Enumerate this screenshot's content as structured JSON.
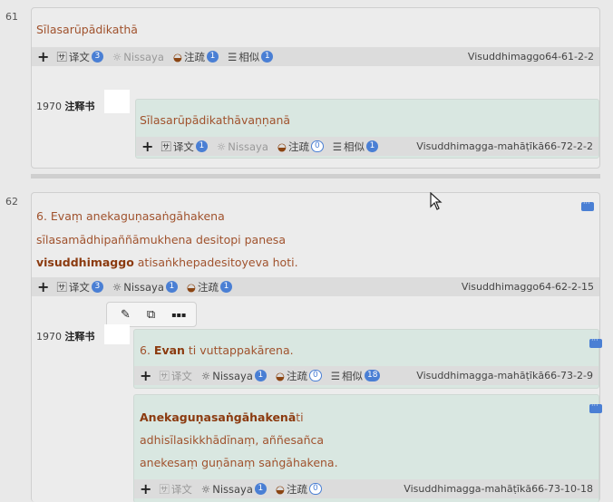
{
  "p61": {
    "num": "61",
    "title": "Sīlasarūpādikathā",
    "toolbar": {
      "plus": "+",
      "trans": "译文",
      "trans_count": "3",
      "nissaya": "Nissaya",
      "comm": "注疏",
      "comm_count": "1",
      "similar": "相似",
      "similar_count": "1"
    },
    "ref": "Visuddhimaggo64-61-2-2",
    "year": "1970",
    "book": "注释书",
    "comm_card": {
      "title": "Sīlasarūpādikathāvaṇṇanā",
      "toolbar": {
        "plus": "+",
        "trans": "译文",
        "trans_count": "1",
        "nissaya": "Nissaya",
        "comm": "注疏",
        "comm_count": "0",
        "similar": "相似",
        "similar_count": "1"
      },
      "ref": "Visuddhimagga-mahāṭīkā66-72-2-2"
    }
  },
  "p62": {
    "num": "62",
    "line1": "6. Evaṃ anekaguṇasaṅgāhakena",
    "line2": "sīlasamādhipaññāmukhena desitopi panesa",
    "line3_bold": "visuddhimaggo",
    "line3_rest": " atisaṅkhepadesitoyeva hoti.",
    "toolbar": {
      "plus": "+",
      "trans": "译文",
      "trans_count": "3",
      "nissaya": "Nissaya",
      "nissaya_count": "1",
      "comm": "注疏",
      "comm_count": "1"
    },
    "ref": "Visuddhimaggo64-62-2-15",
    "year": "1970",
    "book": "注释书",
    "comm1": {
      "prefix": "6. ",
      "bold": "Evan",
      "rest": " ti vuttappakārena.",
      "toolbar": {
        "plus": "+",
        "trans": "译文",
        "nissaya": "Nissaya",
        "nissaya_count": "1",
        "comm": "注疏",
        "comm_count": "0",
        "similar": "相似",
        "similar_count": "18"
      },
      "ref": "Visuddhimagga-mahāṭīkā66-73-2-9"
    },
    "comm2": {
      "bold": "Anekaguṇasaṅgāhakenā",
      "rest1": "ti",
      "line2": "adhisīlasikkhādīnaṃ, aññesañca",
      "line3": "anekesaṃ guṇānaṃ saṅgāhakena.",
      "toolbar": {
        "plus": "+",
        "trans": "译文",
        "nissaya": "Nissaya",
        "nissaya_count": "1",
        "comm": "注疏",
        "comm_count": "0"
      },
      "ref": "Visuddhimagga-mahāṭīkā66-73-10-18"
    }
  },
  "popup": {
    "edit": "✎",
    "copy": "⧉",
    "more": "▪▪▪"
  },
  "colors": {
    "pali_text": "#a0522d",
    "badge": "#4a7fd4",
    "comm_bg": "#d9e7e1"
  }
}
